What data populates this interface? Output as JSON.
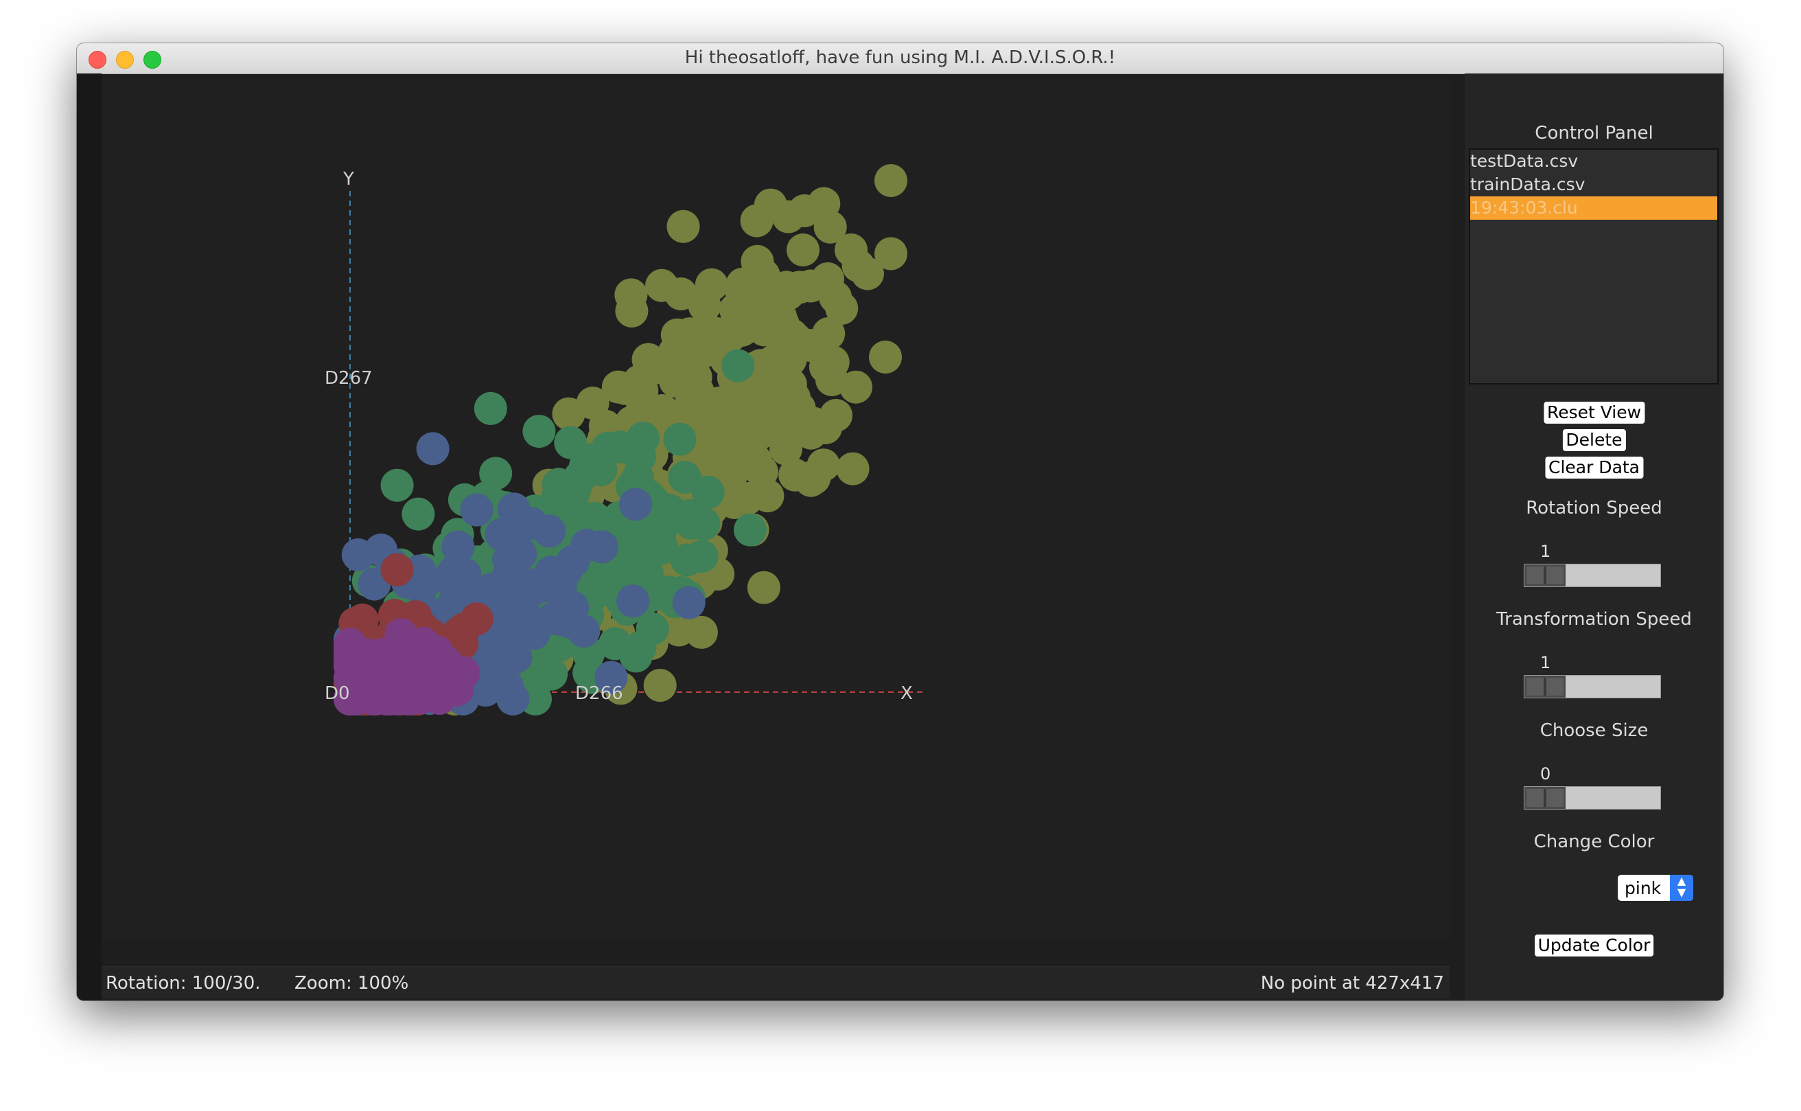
{
  "window": {
    "title": "Hi theosatloff, have fun using M.I. A.D.V.I.S.O.R.!"
  },
  "plot": {
    "axis_y_label": "Y",
    "axis_x_label": "X",
    "y_dim_label": "D267",
    "x_dim_label": "D266",
    "origin_label": "D0",
    "clusters": [
      {
        "name": "olive",
        "color": "#76803f"
      },
      {
        "name": "green",
        "color": "#3f8159"
      },
      {
        "name": "blue",
        "color": "#495f8c"
      },
      {
        "name": "red",
        "color": "#8a3b3d"
      },
      {
        "name": "purple",
        "color": "#7a3d84"
      }
    ],
    "axis_y_color": "#3f7fa6",
    "axis_x_color": "#c2403f"
  },
  "status": {
    "rotation": "Rotation: 100/30.",
    "zoom": "Zoom: 100%",
    "point_info": "No point at 427x417"
  },
  "panel": {
    "title": "Control Panel",
    "files": [
      {
        "name": "testData.csv",
        "selected": false
      },
      {
        "name": "trainData.csv",
        "selected": false
      },
      {
        "name": "19:43:03.clu",
        "selected": true
      }
    ],
    "buttons": {
      "reset": "Reset View",
      "delete": "Delete",
      "clear": "Clear Data",
      "update_color": "Update Color"
    },
    "rotation_speed": {
      "label": "Rotation Speed",
      "value": "1"
    },
    "transformation_speed": {
      "label": "Transformation Speed",
      "value": "1"
    },
    "choose_size": {
      "label": "Choose Size",
      "value": "0"
    },
    "change_color": {
      "label": "Change Color",
      "selected": "pink"
    }
  }
}
